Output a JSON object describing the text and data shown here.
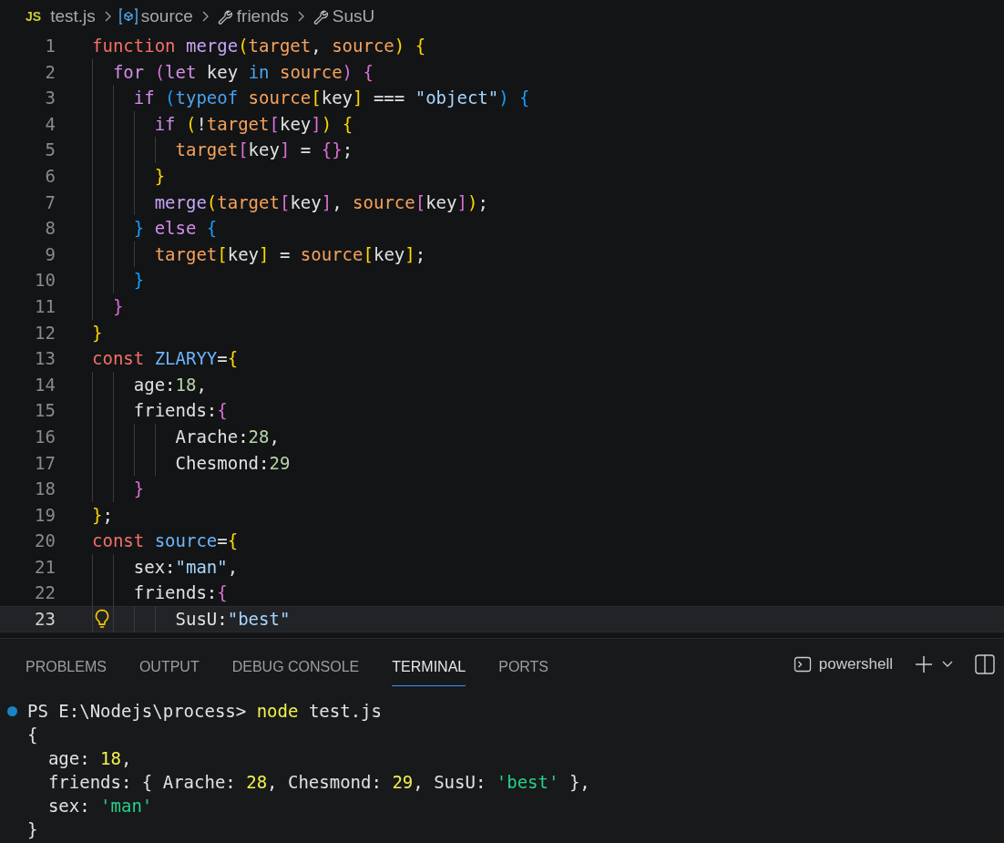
{
  "breadcrumb": [
    {
      "kind": "file",
      "badge": "JS",
      "label": "test.js"
    },
    {
      "kind": "variable",
      "label": "source"
    },
    {
      "kind": "property",
      "label": "friends"
    },
    {
      "kind": "property",
      "label": "SusU"
    }
  ],
  "editor": {
    "lines": [
      {
        "number": "1",
        "current": false,
        "lightbulb": false,
        "tokens": [
          {
            "kind": "storage",
            "text": "function"
          },
          {
            "kind": "function",
            "text": " merge"
          },
          {
            "kind": "bracket1",
            "text": "("
          },
          {
            "kind": "variable",
            "text": "target"
          },
          {
            "kind": "plain",
            "text": ", "
          },
          {
            "kind": "variable",
            "text": "source"
          },
          {
            "kind": "bracket1",
            "text": ")"
          },
          {
            "kind": "bracket1",
            "text": " {"
          }
        ]
      },
      {
        "number": "2",
        "current": false,
        "lightbulb": false,
        "tokens": [
          {
            "kind": "control",
            "text": "  for"
          },
          {
            "kind": "bracket2",
            "text": " ("
          },
          {
            "kind": "control",
            "text": "let"
          },
          {
            "kind": "plain",
            "text": " key "
          },
          {
            "kind": "keyword",
            "text": "in"
          },
          {
            "kind": "variable",
            "text": " source"
          },
          {
            "kind": "bracket2",
            "text": ")"
          },
          {
            "kind": "bracket2",
            "text": " {"
          }
        ]
      },
      {
        "number": "3",
        "current": false,
        "lightbulb": false,
        "tokens": [
          {
            "kind": "control",
            "text": "    if"
          },
          {
            "kind": "bracket3",
            "text": " ("
          },
          {
            "kind": "keyword",
            "text": "typeof"
          },
          {
            "kind": "variable",
            "text": " source"
          },
          {
            "kind": "bracket1",
            "text": "["
          },
          {
            "kind": "plain",
            "text": "key"
          },
          {
            "kind": "bracket1",
            "text": "]"
          },
          {
            "kind": "plain",
            "text": " === "
          },
          {
            "kind": "string",
            "text": "\"object\""
          },
          {
            "kind": "bracket3",
            "text": ")"
          },
          {
            "kind": "bracket3",
            "text": " {"
          }
        ]
      },
      {
        "number": "4",
        "current": false,
        "lightbulb": false,
        "tokens": [
          {
            "kind": "control",
            "text": "      if"
          },
          {
            "kind": "bracket1",
            "text": " ("
          },
          {
            "kind": "plain",
            "text": "!"
          },
          {
            "kind": "variable",
            "text": "target"
          },
          {
            "kind": "bracket2",
            "text": "["
          },
          {
            "kind": "plain",
            "text": "key"
          },
          {
            "kind": "bracket2",
            "text": "]"
          },
          {
            "kind": "bracket1",
            "text": ")"
          },
          {
            "kind": "bracket1",
            "text": " {"
          }
        ]
      },
      {
        "number": "5",
        "current": false,
        "lightbulb": false,
        "tokens": [
          {
            "kind": "variable",
            "text": "        target"
          },
          {
            "kind": "bracket2",
            "text": "["
          },
          {
            "kind": "plain",
            "text": "key"
          },
          {
            "kind": "bracket2",
            "text": "]"
          },
          {
            "kind": "plain",
            "text": " = "
          },
          {
            "kind": "bracket2",
            "text": "{"
          },
          {
            "kind": "bracket2",
            "text": "}"
          },
          {
            "kind": "plain",
            "text": ";"
          }
        ]
      },
      {
        "number": "6",
        "current": false,
        "lightbulb": false,
        "tokens": [
          {
            "kind": "bracket1",
            "text": "      }"
          }
        ]
      },
      {
        "number": "7",
        "current": false,
        "lightbulb": false,
        "tokens": [
          {
            "kind": "function",
            "text": "      merge"
          },
          {
            "kind": "bracket1",
            "text": "("
          },
          {
            "kind": "variable",
            "text": "target"
          },
          {
            "kind": "bracket2",
            "text": "["
          },
          {
            "kind": "plain",
            "text": "key"
          },
          {
            "kind": "bracket2",
            "text": "]"
          },
          {
            "kind": "plain",
            "text": ", "
          },
          {
            "kind": "variable",
            "text": "source"
          },
          {
            "kind": "bracket2",
            "text": "["
          },
          {
            "kind": "plain",
            "text": "key"
          },
          {
            "kind": "bracket2",
            "text": "]"
          },
          {
            "kind": "bracket1",
            "text": ")"
          },
          {
            "kind": "plain",
            "text": ";"
          }
        ]
      },
      {
        "number": "8",
        "current": false,
        "lightbulb": false,
        "tokens": [
          {
            "kind": "bracket3",
            "text": "    }"
          },
          {
            "kind": "control",
            "text": " else"
          },
          {
            "kind": "bracket3",
            "text": " {"
          }
        ]
      },
      {
        "number": "9",
        "current": false,
        "lightbulb": false,
        "tokens": [
          {
            "kind": "variable",
            "text": "      target"
          },
          {
            "kind": "bracket1",
            "text": "["
          },
          {
            "kind": "plain",
            "text": "key"
          },
          {
            "kind": "bracket1",
            "text": "]"
          },
          {
            "kind": "plain",
            "text": " = "
          },
          {
            "kind": "variable",
            "text": "source"
          },
          {
            "kind": "bracket1",
            "text": "["
          },
          {
            "kind": "plain",
            "text": "key"
          },
          {
            "kind": "bracket1",
            "text": "]"
          },
          {
            "kind": "plain",
            "text": ";"
          }
        ]
      },
      {
        "number": "10",
        "current": false,
        "lightbulb": false,
        "tokens": [
          {
            "kind": "bracket3",
            "text": "    }"
          }
        ]
      },
      {
        "number": "11",
        "current": false,
        "lightbulb": false,
        "tokens": [
          {
            "kind": "bracket2",
            "text": "  }"
          }
        ]
      },
      {
        "number": "12",
        "current": false,
        "lightbulb": false,
        "tokens": [
          {
            "kind": "bracket1",
            "text": "}"
          }
        ]
      },
      {
        "number": "13",
        "current": false,
        "lightbulb": false,
        "tokens": [
          {
            "kind": "storage",
            "text": "const"
          },
          {
            "kind": "constant",
            "text": " ZLARYY"
          },
          {
            "kind": "plain",
            "text": "="
          },
          {
            "kind": "bracket1",
            "text": "{"
          }
        ]
      },
      {
        "number": "14",
        "current": false,
        "lightbulb": false,
        "tokens": [
          {
            "kind": "plain",
            "text": "    age:"
          },
          {
            "kind": "number",
            "text": "18"
          },
          {
            "kind": "plain",
            "text": ","
          }
        ]
      },
      {
        "number": "15",
        "current": false,
        "lightbulb": false,
        "tokens": [
          {
            "kind": "plain",
            "text": "    friends:"
          },
          {
            "kind": "bracket2",
            "text": "{"
          }
        ]
      },
      {
        "number": "16",
        "current": false,
        "lightbulb": false,
        "tokens": [
          {
            "kind": "plain",
            "text": "        Arache:"
          },
          {
            "kind": "number",
            "text": "28"
          },
          {
            "kind": "plain",
            "text": ","
          }
        ]
      },
      {
        "number": "17",
        "current": false,
        "lightbulb": false,
        "tokens": [
          {
            "kind": "plain",
            "text": "        Chesmond:"
          },
          {
            "kind": "number",
            "text": "29"
          }
        ]
      },
      {
        "number": "18",
        "current": false,
        "lightbulb": false,
        "tokens": [
          {
            "kind": "bracket2",
            "text": "    }"
          }
        ]
      },
      {
        "number": "19",
        "current": false,
        "lightbulb": false,
        "tokens": [
          {
            "kind": "bracket1",
            "text": "}"
          },
          {
            "kind": "plain",
            "text": ";"
          }
        ]
      },
      {
        "number": "20",
        "current": false,
        "lightbulb": false,
        "tokens": [
          {
            "kind": "storage",
            "text": "const"
          },
          {
            "kind": "constant",
            "text": " source"
          },
          {
            "kind": "plain",
            "text": "="
          },
          {
            "kind": "bracket1",
            "text": "{"
          }
        ]
      },
      {
        "number": "21",
        "current": false,
        "lightbulb": false,
        "tokens": [
          {
            "kind": "plain",
            "text": "    sex:"
          },
          {
            "kind": "string",
            "text": "\"man\""
          },
          {
            "kind": "plain",
            "text": ","
          }
        ]
      },
      {
        "number": "22",
        "current": false,
        "lightbulb": false,
        "tokens": [
          {
            "kind": "plain",
            "text": "    friends:"
          },
          {
            "kind": "bracket2",
            "text": "{"
          }
        ]
      },
      {
        "number": "23",
        "current": true,
        "lightbulb": true,
        "tokens": [
          {
            "kind": "plain",
            "text": "        SusU:"
          },
          {
            "kind": "string",
            "text": "\"best\""
          }
        ]
      }
    ]
  },
  "panel": {
    "tabs": [
      {
        "label": "PROBLEMS",
        "selected": false
      },
      {
        "label": "OUTPUT",
        "selected": false
      },
      {
        "label": "DEBUG CONSOLE",
        "selected": false
      },
      {
        "label": "TERMINAL",
        "selected": true
      },
      {
        "label": "PORTS",
        "selected": false
      }
    ],
    "shell": "powershell",
    "terminal": [
      {
        "decorated": true,
        "tokens": [
          {
            "kind": "plain",
            "text": "PS E:\\Nodejs\\process> "
          },
          {
            "kind": "command",
            "text": "node"
          },
          {
            "kind": "plain",
            "text": " test.js"
          }
        ]
      },
      {
        "decorated": false,
        "tokens": [
          {
            "kind": "plain",
            "text": "{"
          }
        ]
      },
      {
        "decorated": false,
        "tokens": [
          {
            "kind": "plain",
            "text": "  age: "
          },
          {
            "kind": "number",
            "text": "18"
          },
          {
            "kind": "plain",
            "text": ","
          }
        ]
      },
      {
        "decorated": false,
        "tokens": [
          {
            "kind": "plain",
            "text": "  friends: { Arache: "
          },
          {
            "kind": "number",
            "text": "28"
          },
          {
            "kind": "plain",
            "text": ", Chesmond: "
          },
          {
            "kind": "number",
            "text": "29"
          },
          {
            "kind": "plain",
            "text": ", SusU: "
          },
          {
            "kind": "string",
            "text": "'best'"
          },
          {
            "kind": "plain",
            "text": " },"
          }
        ]
      },
      {
        "decorated": false,
        "tokens": [
          {
            "kind": "plain",
            "text": "  sex: "
          },
          {
            "kind": "string",
            "text": "'man'"
          }
        ]
      },
      {
        "decorated": false,
        "tokens": [
          {
            "kind": "plain",
            "text": "}"
          }
        ]
      }
    ]
  }
}
